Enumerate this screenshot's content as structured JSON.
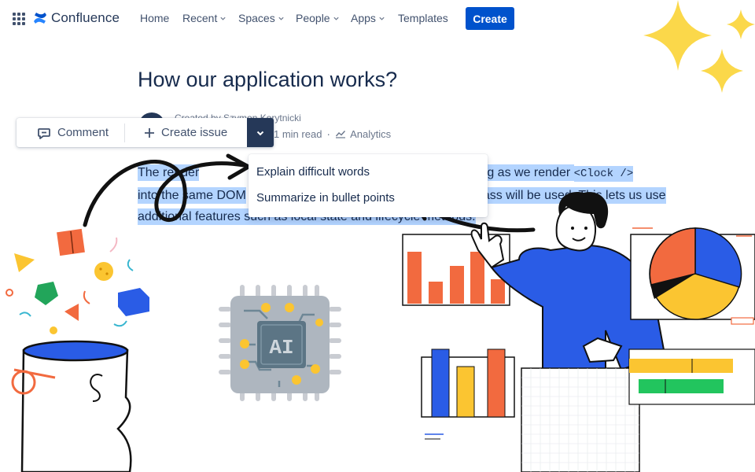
{
  "app": {
    "name": "Confluence"
  },
  "nav": {
    "items": [
      {
        "label": "Home",
        "has_dropdown": false
      },
      {
        "label": "Recent",
        "has_dropdown": true
      },
      {
        "label": "Spaces",
        "has_dropdown": true
      },
      {
        "label": "People",
        "has_dropdown": true
      },
      {
        "label": "Apps",
        "has_dropdown": true
      },
      {
        "label": "Templates",
        "has_dropdown": false
      }
    ],
    "create_label": "Create"
  },
  "page": {
    "title": "How our application works?",
    "created_by": "Created by Szymon Korytnicki",
    "read_time": "1 min read",
    "analytics_label": "Analytics",
    "paragraph": {
      "line1_a": "The  render",
      "line1_b": "ens, but as long as we render ",
      "code": "<Clock />",
      "line2_a": "into the same DOM",
      "line2_b": " class will be used. This lets us use",
      "line3": "additional features such as local state and lifecycle methods."
    }
  },
  "toolbar": {
    "comment_label": "Comment",
    "create_issue_label": "Create issue"
  },
  "ai_menu": {
    "items": [
      "Explain difficult words",
      "Summarize in bullet points"
    ]
  },
  "chip": {
    "label": "AI"
  },
  "icons": {
    "app_switcher": "app-switcher-grid-icon",
    "logo": "confluence-logo-icon",
    "comment": "comment-icon",
    "plus": "plus-icon",
    "chevron": "chevron-down-icon",
    "analytics": "analytics-chart-icon"
  },
  "colors": {
    "brand_blue": "#0052cc",
    "selection": "#b3d4ff",
    "dark_navy": "#253858",
    "illustration_blue": "#2a5ce6",
    "illustration_orange": "#f26a3f",
    "illustration_yellow": "#fbc531",
    "sparkle_yellow": "#fbd84a"
  }
}
